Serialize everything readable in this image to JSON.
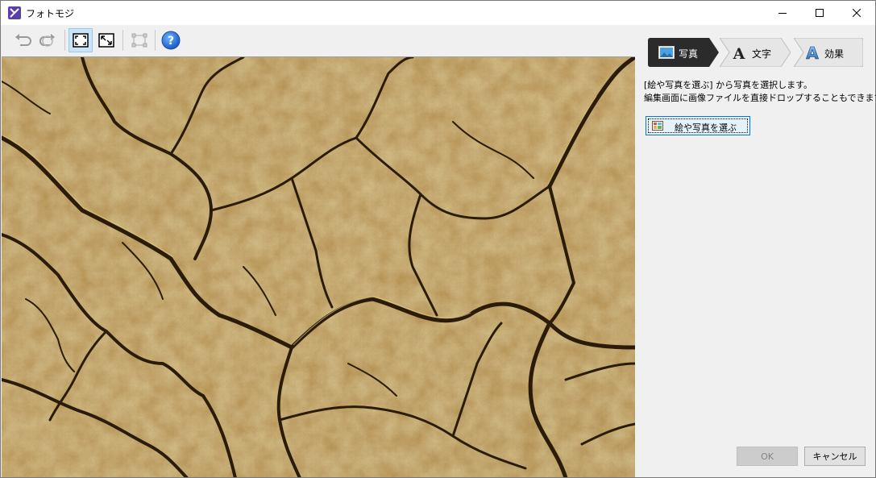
{
  "window": {
    "title": "フォトモジ"
  },
  "toolbar": {
    "buttons": [
      {
        "icon": "undo-icon",
        "enabled": false
      },
      {
        "icon": "redo-icon",
        "enabled": false
      },
      {
        "icon": "fit-to-window-icon",
        "active": true
      },
      {
        "icon": "actual-size-icon",
        "active": false
      },
      {
        "icon": "crop-selection-icon",
        "enabled": false
      },
      {
        "icon": "help-icon",
        "label": "?"
      }
    ]
  },
  "steps": {
    "photo": "写真",
    "text": "文字",
    "effect": "効果"
  },
  "panel": {
    "description_line1": "[絵や写真を選ぶ] から写真を選択します。",
    "description_line2": "編集画面に画像ファイルを直接ドロップすることもできます。",
    "select_button_label": "絵や写真を選ぶ",
    "ok_label": "OK",
    "cancel_label": "キャンセル"
  },
  "colors": {
    "active_step": "#2b2b2b",
    "inactive_step": "#e8e8e8",
    "accent": "#0078d7",
    "photo_base": "#b8934a"
  }
}
